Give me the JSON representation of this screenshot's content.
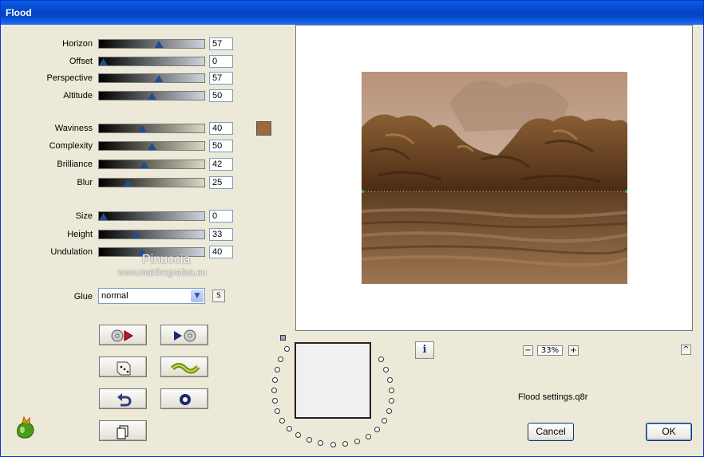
{
  "window": {
    "title": "Flood"
  },
  "sliders": [
    {
      "label": "Horizon",
      "value": "57",
      "level": 0.57
    },
    {
      "label": "Offset",
      "value": "0",
      "level": 0.0
    },
    {
      "label": "Perspective",
      "value": "57",
      "level": 0.57
    },
    {
      "label": "Altitude",
      "value": "50",
      "level": 0.5
    },
    {
      "label": "Waviness",
      "value": "40",
      "level": 0.4
    },
    {
      "label": "Complexity",
      "value": "50",
      "level": 0.5
    },
    {
      "label": "Brilliance",
      "value": "42",
      "level": 0.42
    },
    {
      "label": "Blur",
      "value": "25",
      "level": 0.25
    },
    {
      "label": "Size",
      "value": "0",
      "level": 0.0
    },
    {
      "label": "Height",
      "value": "33",
      "level": 0.33
    },
    {
      "label": "Undulation",
      "value": "40",
      "level": 0.4
    }
  ],
  "color_swatch": "#9a6b3e",
  "glue": {
    "label": "Glue",
    "value": "normal",
    "s_button": "S"
  },
  "watermark": {
    "name": "Pinuccia",
    "url": "www.maidiregrafica.eu"
  },
  "tool_buttons": [
    {
      "icon": "reset-to-original-icon"
    },
    {
      "icon": "play-forward-icon"
    },
    {
      "icon": "random-dice-icon"
    },
    {
      "icon": "wave-icon"
    },
    {
      "icon": "undo-icon"
    },
    {
      "icon": "record-icon"
    },
    {
      "icon": "copy-icon"
    }
  ],
  "info_button": "i",
  "zoom": {
    "minus": "−",
    "level": "33%",
    "plus": "+"
  },
  "scroll_up": "^",
  "settings_file": "Flood settings.q8r",
  "buttons": {
    "cancel": "Cancel",
    "ok": "OK"
  },
  "colors": {
    "titlebar": "#0a5ee8",
    "slider_thumb": "#1f4e8f",
    "dialog_bg": "#ece9d8"
  }
}
